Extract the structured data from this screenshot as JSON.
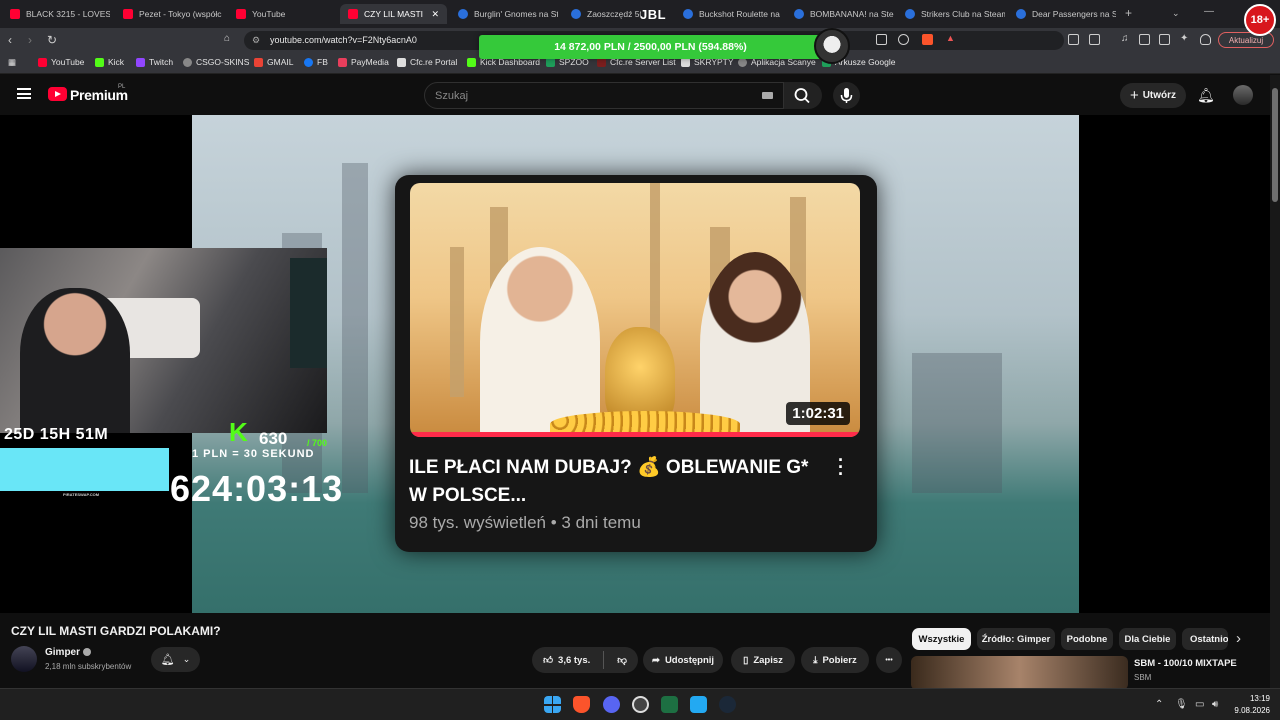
{
  "browser": {
    "tabs": [
      {
        "label": "BLACK 3215 - LOVEST",
        "favicon": "youtube-icon"
      },
      {
        "label": "Pezet - Tokyo (współc",
        "favicon": "youtube-icon"
      },
      {
        "label": "YouTube",
        "favicon": "youtube-icon"
      },
      {
        "label": "CZY LIL MASTI",
        "favicon": "youtube-icon",
        "active": true
      },
      {
        "label": "Burglin' Gnomes na St",
        "favicon": "steam-icon"
      },
      {
        "label": "Zaoszczędź 50%",
        "favicon": "steam-icon"
      },
      {
        "label": "Buckshot Roulette na",
        "favicon": "steam-icon"
      },
      {
        "label": "BOMBANANA! na Ste",
        "favicon": "steam-icon"
      },
      {
        "label": "Strikers Club na Steam",
        "favicon": "steam-icon"
      },
      {
        "label": "Dear Passengers na St",
        "favicon": "steam-icon"
      }
    ],
    "new_tab": "+",
    "url": "youtube.com/watch?v=F2Nty6acnA0",
    "update_label": "Aktualizuj",
    "bookmarks": [
      "YouTube",
      "Kick",
      "Twitch",
      "CSGO-SKINS",
      "GMAIL",
      "FB",
      "PayMedia",
      "Cfc.re Portal",
      "Kick Dashboard",
      "SPZOO",
      "Cfc.re Server List",
      "SKRYPTY",
      "Aplikacja Scanye",
      "Arkusze Google"
    ],
    "accent_color": "#ff0033"
  },
  "overlay": {
    "balance_banner": "14 872,00 PLN / 2500,00 PLN  (594.88%)",
    "logo_text": "JBL",
    "age_badge": "18+",
    "countdown_days": "25D 15H 51M",
    "kick_count": "630",
    "kick_goal": "/ 700",
    "rate": "1 PLN = 30 SEKUND",
    "sponsor": "PIRATESWAP.COM",
    "big_timer": "624:03:13",
    "kick_color": "#53fc18"
  },
  "youtube": {
    "brand": "Premium",
    "region": "PL",
    "search_placeholder": "Szukaj",
    "create_label": "Utwórz",
    "card": {
      "title": "ILE PŁACI NAM DUBAJ? 💰 OBLEWANIE G* W POLSCE...",
      "meta": "98 tys. wyświetleń • 3 dni temu",
      "duration": "1:02:31"
    },
    "video_title": "CZY LIL MASTI GARDZI POLAKAMI?",
    "channel": {
      "name": "Gimper",
      "subs": "2,18 mln subskrybentów"
    },
    "actions": {
      "likes": "3,6 tys.",
      "share": "Udostępnij",
      "save": "Zapisz",
      "download": "Pobierz",
      "more": "•••"
    },
    "chips": [
      "Wszystkie",
      "Źródło: Gimper",
      "Podobne",
      "Dla Ciebie",
      "Ostatnio"
    ],
    "recommendation": {
      "title": "SBM - 100/10 MIXTAPE",
      "channel": "SBM"
    }
  },
  "taskbar": {
    "time": "13:19",
    "date": "9.08.2026"
  }
}
